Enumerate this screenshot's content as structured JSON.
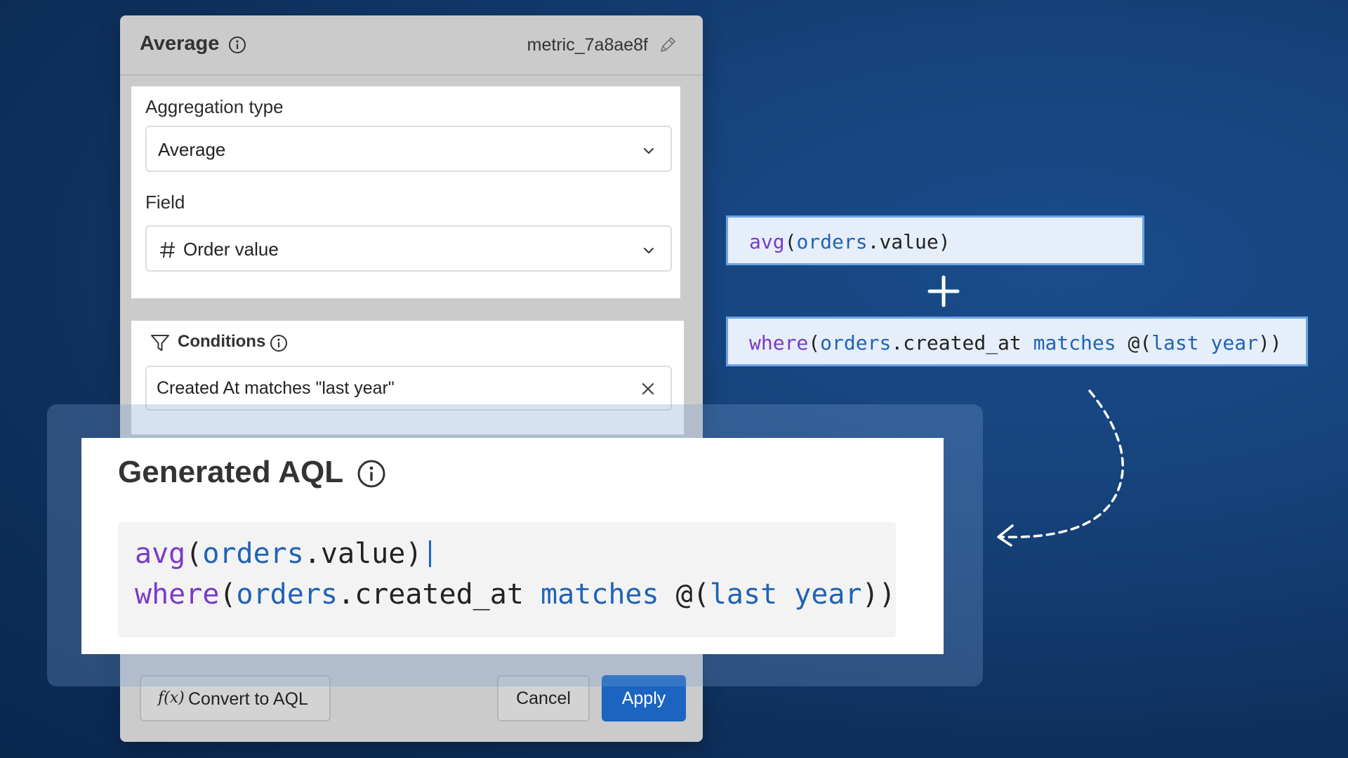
{
  "dialog": {
    "title": "Average",
    "metric_id": "metric_7a8ae8f",
    "aggregation": {
      "label": "Aggregation type",
      "value": "Average"
    },
    "field": {
      "label": "Field",
      "icon": "hash-icon",
      "value": "Order value"
    },
    "conditions": {
      "label": "Conditions",
      "value": "Created At matches \"last year\""
    },
    "buttons": {
      "convert_icon": "f(x)",
      "convert": "Convert to AQL",
      "cancel": "Cancel",
      "apply": "Apply"
    }
  },
  "generated_aql": {
    "title": "Generated AQL",
    "line1": {
      "fn": "avg",
      "open": "(",
      "id": "orders",
      "rest": ".value)"
    },
    "line2": {
      "fn": "where",
      "open": "(",
      "id": "orders",
      "mid": ".created_at ",
      "kw": "matches",
      "at": " @(",
      "w1": "last",
      "sp": " ",
      "w2": "year",
      "close": "))"
    }
  },
  "chips": {
    "chip1": {
      "fn": "avg",
      "open": "(",
      "id": "orders",
      "rest": ".value)"
    },
    "chip2": {
      "fn": "where",
      "open": "(",
      "id": "orders",
      "mid": ".created_at ",
      "kw": "matches",
      "at": " @(",
      "w1": "last",
      "sp": " ",
      "w2": "year",
      "close": "))"
    }
  },
  "colors": {
    "accent": "#1b65c0",
    "function": "#7a3bc7",
    "identifier": "#1f63b5",
    "chip_border": "#6aa3e6",
    "chip_bg": "#e6eef9"
  }
}
